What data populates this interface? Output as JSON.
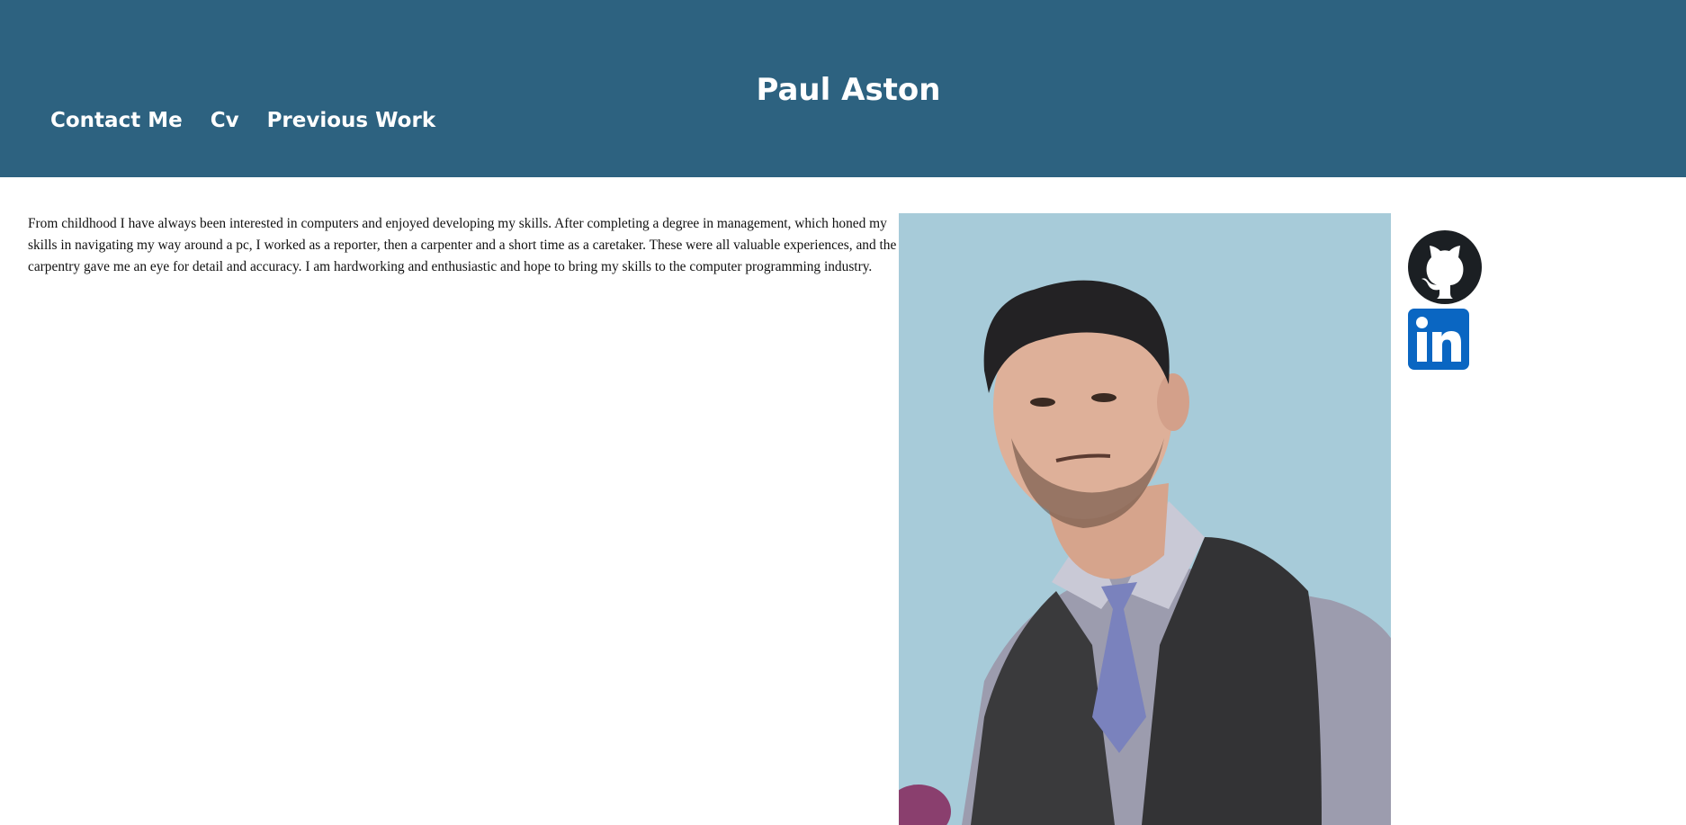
{
  "site": {
    "title": "Paul Aston"
  },
  "nav": {
    "items": [
      {
        "label": "Contact Me"
      },
      {
        "label": "Cv"
      },
      {
        "label": "Previous Work"
      }
    ]
  },
  "main": {
    "bio": "From childhood I have always been interested in computers and enjoyed developing my skills. After completing a degree in management, which honed my skills in navigating my way around a pc, I worked as a reporter, then a carpenter and a short time as a caretaker. These were all valuable experiences, and the carpentry gave me an eye for detail and accuracy. I am hardworking and enthusiastic and hope to bring my skills to the computer programming industry."
  },
  "social": {
    "links": [
      {
        "icon": "github-icon"
      },
      {
        "icon": "linkedin-icon"
      }
    ]
  },
  "colors": {
    "header_bg": "#2d6280",
    "header_text": "#ffffff",
    "photo_bg": "#a7cbd9",
    "linkedin_blue": "#0a66c2"
  }
}
